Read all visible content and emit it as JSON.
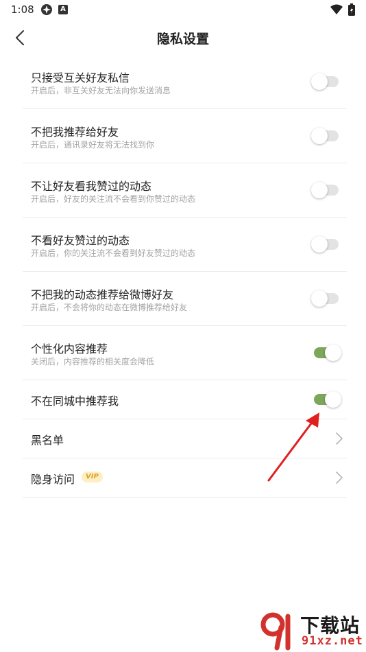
{
  "status_bar": {
    "time": "1:08",
    "notif_badge": "A"
  },
  "header": {
    "title": "隐私设置"
  },
  "settings": [
    {
      "title": "只接受互关好友私信",
      "subtitle": "开启后，非互关好友无法向你发送消息",
      "type": "toggle",
      "on": false
    },
    {
      "title": "不把我推荐给好友",
      "subtitle": "开启后，通讯录好友将无法找到你",
      "type": "toggle",
      "on": false
    },
    {
      "title": "不让好友看我赞过的动态",
      "subtitle": "开启后，好友的关注流不会看到你赞过的动态",
      "type": "toggle",
      "on": false
    },
    {
      "title": "不看好友赞过的动态",
      "subtitle": "开启后，你的关注流不会看到好友赞过的动态",
      "type": "toggle",
      "on": false
    },
    {
      "title": "不把我的动态推荐给微博好友",
      "subtitle": "开启后，不会将你的动态在微博推荐给好友",
      "type": "toggle",
      "on": false
    },
    {
      "title": "个性化内容推荐",
      "subtitle": "关闭后，内容推荐的相关度会降低",
      "type": "toggle",
      "on": true
    },
    {
      "title": "不在同城中推荐我",
      "type": "toggle",
      "on": true
    },
    {
      "title": "黑名单",
      "type": "link"
    },
    {
      "title": "隐身访问",
      "type": "link",
      "badge": "VIP"
    }
  ],
  "colors": {
    "toggle_on": "#7da65a",
    "toggle_off": "#e3e3e3",
    "annotation_arrow": "#e0201f",
    "vip_badge_bg": "#fdefc3",
    "vip_badge_text": "#d9a326"
  },
  "watermark": {
    "brand": "下载站",
    "url": "91xz.net"
  }
}
